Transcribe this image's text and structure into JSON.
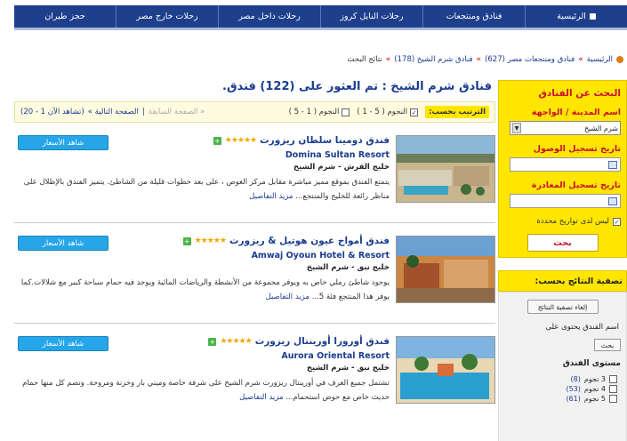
{
  "nav": [
    {
      "label": "الرئيسية",
      "icon": "home-icon"
    },
    {
      "label": "فنادق ومنتجعات"
    },
    {
      "label": "رحلات النايل كروز"
    },
    {
      "label": "رحلات داخل مصر"
    },
    {
      "label": "رحلات خارج مصر"
    },
    {
      "label": "حجز طيران"
    }
  ],
  "breadcrumb": {
    "home": "الرئيسية",
    "level2": "فنادق ومنتجعات مصر (627)",
    "level3": "فنادق شرم الشيخ (178)",
    "current": "نتائج البحث"
  },
  "results": {
    "title": "فنادق شرم الشيخ : تم العثور على (122) فندق.",
    "sort_label": "الترتيب بحسب:",
    "sort_opt1": "النجوم ( 5 - 1 )",
    "sort_opt2": "النجوم ( 1 - 5 )",
    "pager_prev": "« الصفحة السابقة",
    "pager_next": "الصفحة التالية »",
    "pager_info": "(تشاهد الآن 1 - 20)",
    "sep": "|"
  },
  "hotels": [
    {
      "name_ar": "فندق دومينا سلطان ريزورت",
      "stars": "★★★★★",
      "name_en": "Domina Sultan Resort",
      "location": "خليج القرش - شرم الشيخ",
      "desc": "يتمتع الفندق بموقع مميز مباشرة مقابل مركز الغوص ، على بعد خطوات قليلة من الشاطئ. يتميز الفندق بالإطلال على مناظر رائعة للخليج والمنتجع...",
      "more": "مزيد التفاصيل",
      "price_label": "شاهد الأسعار"
    },
    {
      "name_ar": "فندق أمواج عيون هوتيل & ريزورت",
      "stars": "★★★★★",
      "name_en": "Amwaj Oyoun Hotel & Resort",
      "location": "خليج نبق - شرم الشيخ",
      "desc": "يوجود شاطئ رملي خاص به ويوفر مجموعة من الأنشطة والرياضات المائية ويوجد فيه حمام سباحة كبير مع شلالات.كما يوفر هذا المنتجع فئة 5...",
      "more": "مزيد التفاصيل",
      "price_label": "شاهد الأسعار"
    },
    {
      "name_ar": "فندق أورورا أورينتال ريزورت",
      "stars": "★★★★★",
      "name_en": "Aurora Oriental Resort",
      "location": "خليج نبق - شرم الشيخ",
      "desc": "تشتمل جميع الغرف في أورينتال ريزورت شرم الشيخ على شرفة خاصة وميني بار وخزنة ومروحة. وتضم كل منها حمام حديث خاص مع حوض استحمام...",
      "more": "مزيد التفاصيل",
      "price_label": "شاهد الأسعار"
    }
  ],
  "search": {
    "title": "البحث عن الفنادق",
    "city_label": "اسم المدينة / الواجهة",
    "city_value": "شرم الشيخ",
    "checkin_label": "تاريخ تسجيل الوصول",
    "checkout_label": "تاريخ تسجيل المغادرة",
    "no_dates": "ليس لدى تواريخ محددة",
    "button": "بحث"
  },
  "filter": {
    "title": "تصفية النتائج بحسب:",
    "reset": "إلغاء تصفية النتائج",
    "contains": "اسم الفندق يحتوى على",
    "go": "بحث",
    "level_title": "مستوى الفندق",
    "levels": [
      {
        "label": "3 نجوم",
        "count": "(8)"
      },
      {
        "label": "4 نجوم",
        "count": "(53)"
      },
      {
        "label": "5 نجوم",
        "count": "(61)"
      }
    ]
  }
}
